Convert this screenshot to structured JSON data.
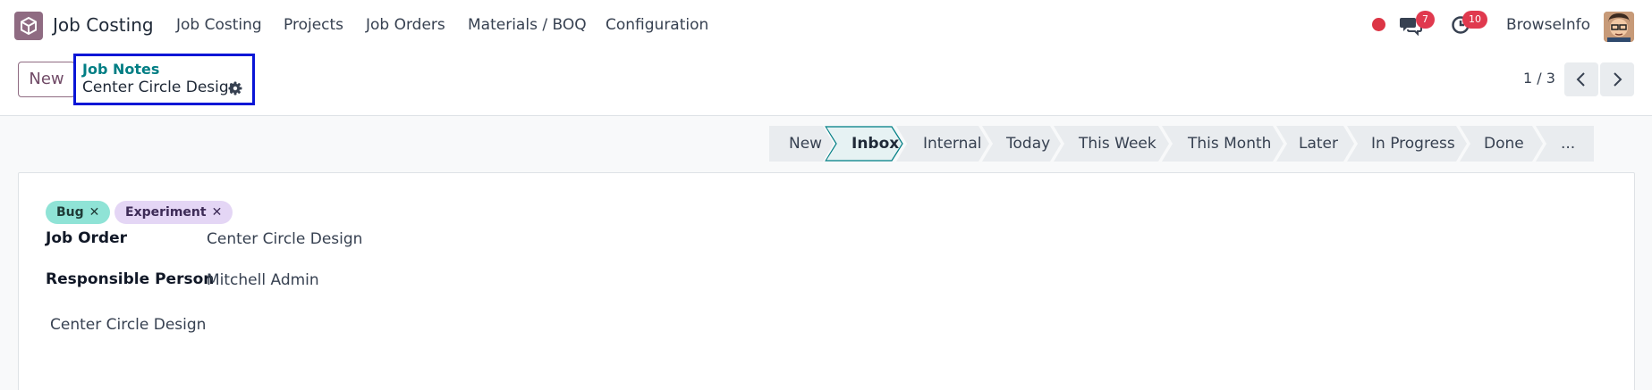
{
  "navbar": {
    "app_name": "Job Costing",
    "menu": [
      "Job Costing",
      "Projects",
      "Job Orders",
      "Materials / BOQ",
      "Configuration"
    ],
    "messages_count": "7",
    "activities_count": "10",
    "company": "BrowseInfo"
  },
  "control": {
    "new_label": "New",
    "breadcrumb_parent": "Job Notes",
    "breadcrumb_current": "Center Circle Design",
    "pager": "1 / 3"
  },
  "stages": {
    "items": [
      "New",
      "Inbox",
      "Internal",
      "Today",
      "This Week",
      "This Month",
      "Later",
      "In Progress",
      "Done",
      "..."
    ],
    "active": "Inbox"
  },
  "form": {
    "tags": [
      {
        "label": "Bug",
        "color": "#8fe3d6"
      },
      {
        "label": "Experiment",
        "color": "#e4d6f5"
      }
    ],
    "job_order_label": "Job Order",
    "job_order_value": "Center Circle Design",
    "responsible_label": "Responsible Person",
    "responsible_value": "Mitchell Admin",
    "note": "Center Circle Design"
  },
  "colors": {
    "brand": "#714b67",
    "accent": "#017e84",
    "highlight_border": "#0a16d6",
    "badge": "#e0394e"
  },
  "icons": [
    "app-logo-icon",
    "chat-icon",
    "clock-icon",
    "gear-icon",
    "chevron-left-icon",
    "chevron-right-icon",
    "remove-icon"
  ]
}
